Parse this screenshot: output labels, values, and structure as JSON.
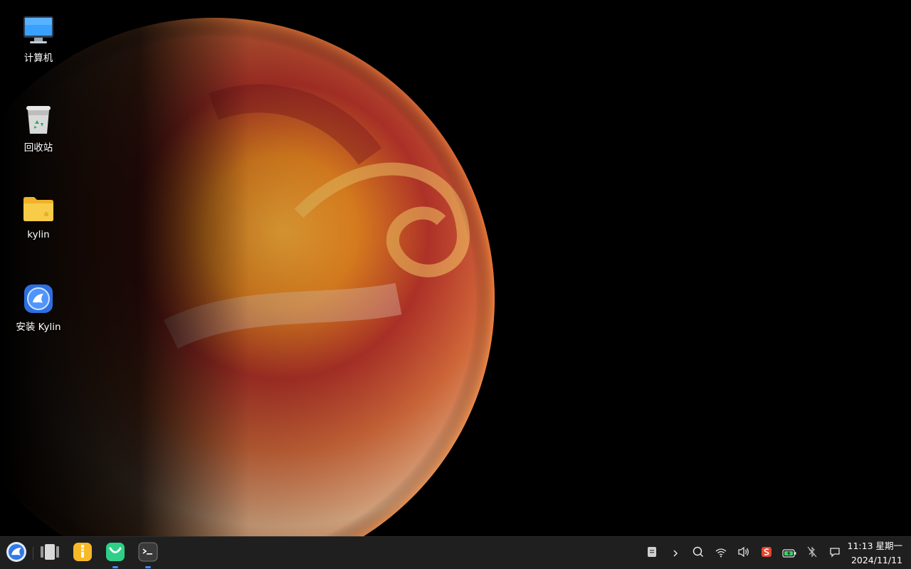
{
  "desktop": {
    "icons": [
      {
        "label": "计算机",
        "icon": "computer-icon"
      },
      {
        "label": "回收站",
        "icon": "trash-icon"
      },
      {
        "label": "kylin",
        "icon": "folder-icon"
      },
      {
        "label": "安装 Kylin",
        "icon": "install-kylin-icon"
      }
    ]
  },
  "taskbar": {
    "start_icon": "kylin-start-icon",
    "apps": [
      {
        "icon": "multitask-view-icon",
        "running": false
      },
      {
        "icon": "file-manager-icon",
        "running": false
      },
      {
        "icon": "software-store-icon",
        "running": true
      },
      {
        "icon": "terminal-icon",
        "running": true
      }
    ],
    "tray": [
      "clipboard-icon",
      "expand-tray-icon",
      "search-icon",
      "wifi-icon",
      "volume-icon",
      "input-method-icon",
      "battery-charging-icon",
      "bluetooth-off-icon",
      "notification-icon"
    ],
    "clock": {
      "time": "11:13 星期一",
      "date": "2024/11/11"
    }
  },
  "colors": {
    "taskbar_bg": "#1f1f1f",
    "indicator": "#3a8fff",
    "folder": "#f6c43a"
  }
}
